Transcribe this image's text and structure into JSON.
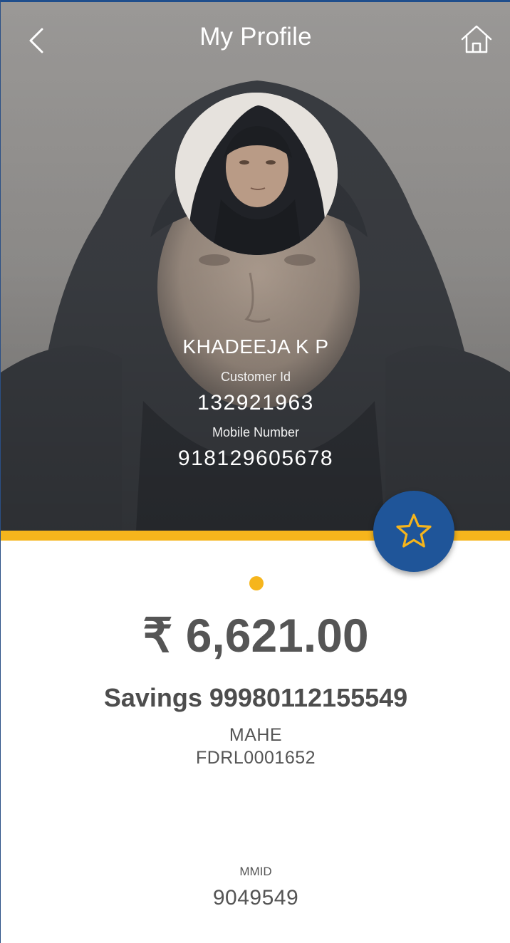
{
  "header": {
    "title": "My Profile",
    "back_icon": "chevron-left-icon",
    "home_icon": "home-icon"
  },
  "profile": {
    "name": "KHADEEJA K P",
    "customer_id_label": "Customer Id",
    "customer_id": "132921963",
    "mobile_label": "Mobile Number",
    "mobile_number": "918129605678"
  },
  "favorite": {
    "icon": "star-icon"
  },
  "account": {
    "balance": "₹ 6,621.00",
    "account_line": "Savings 99980112155549",
    "branch": "MAHE",
    "ifsc": "FDRL0001652",
    "mmid_label": "MMID",
    "mmid": "9049549"
  },
  "colors": {
    "accent": "#f6b51c",
    "primary": "#1f5599",
    "text": "#555555"
  }
}
